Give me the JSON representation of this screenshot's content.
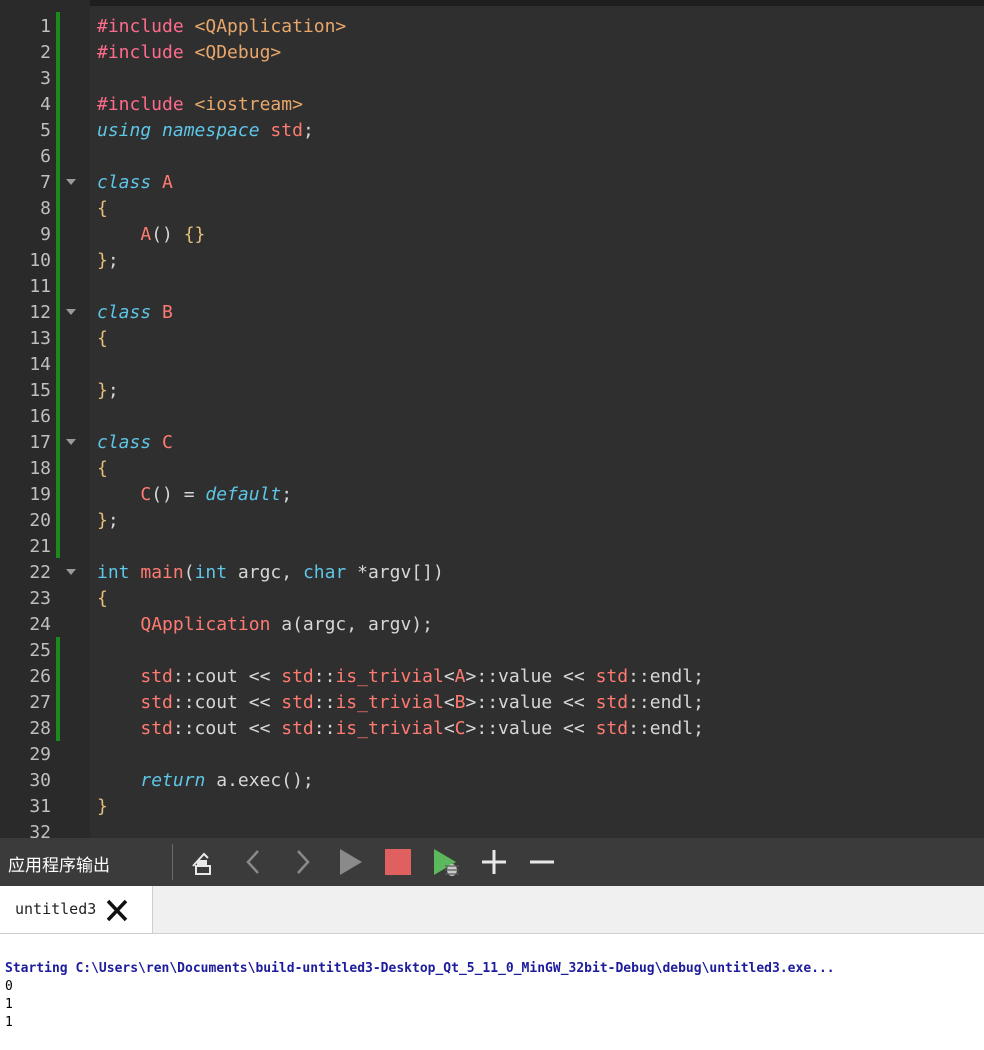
{
  "editor": {
    "lines": [
      {
        "n": "1",
        "tokens": [
          {
            "c": "kw-pp",
            "t": "#include "
          },
          {
            "c": "inc",
            "t": "<QApplication>"
          }
        ]
      },
      {
        "n": "2",
        "tokens": [
          {
            "c": "kw-pp",
            "t": "#include "
          },
          {
            "c": "inc",
            "t": "<QDebug>"
          }
        ]
      },
      {
        "n": "3",
        "tokens": []
      },
      {
        "n": "4",
        "tokens": [
          {
            "c": "kw-pp",
            "t": "#include "
          },
          {
            "c": "inc",
            "t": "<iostream>"
          }
        ]
      },
      {
        "n": "5",
        "tokens": [
          {
            "c": "kw-it",
            "t": "using"
          },
          {
            "c": "plain",
            "t": " "
          },
          {
            "c": "kw-it",
            "t": "namespace"
          },
          {
            "c": "plain",
            "t": " "
          },
          {
            "c": "std",
            "t": "std"
          },
          {
            "c": "plain",
            "t": ";"
          }
        ]
      },
      {
        "n": "6",
        "tokens": []
      },
      {
        "n": "7",
        "fold": true,
        "tokens": [
          {
            "c": "kw-it",
            "t": "class"
          },
          {
            "c": "plain",
            "t": " "
          },
          {
            "c": "type",
            "t": "A"
          }
        ]
      },
      {
        "n": "8",
        "tokens": [
          {
            "c": "punct",
            "t": "{"
          }
        ]
      },
      {
        "n": "9",
        "tokens": [
          {
            "c": "plain",
            "t": "    "
          },
          {
            "c": "type",
            "t": "A"
          },
          {
            "c": "plain",
            "t": "() "
          },
          {
            "c": "punct",
            "t": "{}"
          }
        ]
      },
      {
        "n": "10",
        "tokens": [
          {
            "c": "punct",
            "t": "}"
          },
          {
            "c": "plain",
            "t": ";"
          }
        ]
      },
      {
        "n": "11",
        "tokens": []
      },
      {
        "n": "12",
        "fold": true,
        "tokens": [
          {
            "c": "kw-it",
            "t": "class"
          },
          {
            "c": "plain",
            "t": " "
          },
          {
            "c": "type",
            "t": "B"
          }
        ]
      },
      {
        "n": "13",
        "tokens": [
          {
            "c": "punct",
            "t": "{"
          }
        ]
      },
      {
        "n": "14",
        "tokens": []
      },
      {
        "n": "15",
        "tokens": [
          {
            "c": "punct",
            "t": "}"
          },
          {
            "c": "plain",
            "t": ";"
          }
        ]
      },
      {
        "n": "16",
        "tokens": []
      },
      {
        "n": "17",
        "fold": true,
        "tokens": [
          {
            "c": "kw-it",
            "t": "class"
          },
          {
            "c": "plain",
            "t": " "
          },
          {
            "c": "type",
            "t": "C"
          }
        ]
      },
      {
        "n": "18",
        "tokens": [
          {
            "c": "punct",
            "t": "{"
          }
        ]
      },
      {
        "n": "19",
        "tokens": [
          {
            "c": "plain",
            "t": "    "
          },
          {
            "c": "type",
            "t": "C"
          },
          {
            "c": "plain",
            "t": "() = "
          },
          {
            "c": "kw-it",
            "t": "default"
          },
          {
            "c": "plain",
            "t": ";"
          }
        ]
      },
      {
        "n": "20",
        "tokens": [
          {
            "c": "punct",
            "t": "}"
          },
          {
            "c": "plain",
            "t": ";"
          }
        ]
      },
      {
        "n": "21",
        "tokens": []
      },
      {
        "n": "22",
        "fold": true,
        "tokens": [
          {
            "c": "kw",
            "t": "int"
          },
          {
            "c": "plain",
            "t": " "
          },
          {
            "c": "type",
            "t": "main"
          },
          {
            "c": "plain",
            "t": "("
          },
          {
            "c": "kw",
            "t": "int"
          },
          {
            "c": "plain",
            "t": " argc, "
          },
          {
            "c": "kw",
            "t": "char"
          },
          {
            "c": "plain",
            "t": " *argv[])"
          }
        ]
      },
      {
        "n": "23",
        "tokens": [
          {
            "c": "punct",
            "t": "{"
          }
        ]
      },
      {
        "n": "24",
        "tokens": [
          {
            "c": "plain",
            "t": "    "
          },
          {
            "c": "type",
            "t": "QApplication"
          },
          {
            "c": "plain",
            "t": " a(argc, argv);"
          }
        ]
      },
      {
        "n": "25",
        "tokens": []
      },
      {
        "n": "26",
        "tokens": [
          {
            "c": "plain",
            "t": "    "
          },
          {
            "c": "std",
            "t": "std"
          },
          {
            "c": "plain",
            "t": "::cout << "
          },
          {
            "c": "std",
            "t": "std"
          },
          {
            "c": "plain",
            "t": "::"
          },
          {
            "c": "type",
            "t": "is_trivial"
          },
          {
            "c": "plain",
            "t": "<"
          },
          {
            "c": "type",
            "t": "A"
          },
          {
            "c": "plain",
            "t": ">::value << "
          },
          {
            "c": "std",
            "t": "std"
          },
          {
            "c": "plain",
            "t": "::endl;"
          }
        ]
      },
      {
        "n": "27",
        "tokens": [
          {
            "c": "plain",
            "t": "    "
          },
          {
            "c": "std",
            "t": "std"
          },
          {
            "c": "plain",
            "t": "::cout << "
          },
          {
            "c": "std",
            "t": "std"
          },
          {
            "c": "plain",
            "t": "::"
          },
          {
            "c": "type",
            "t": "is_trivial"
          },
          {
            "c": "plain",
            "t": "<"
          },
          {
            "c": "type",
            "t": "B"
          },
          {
            "c": "plain",
            "t": ">::value << "
          },
          {
            "c": "std",
            "t": "std"
          },
          {
            "c": "plain",
            "t": "::endl;"
          }
        ]
      },
      {
        "n": "28",
        "tokens": [
          {
            "c": "plain",
            "t": "    "
          },
          {
            "c": "std",
            "t": "std"
          },
          {
            "c": "plain",
            "t": "::cout << "
          },
          {
            "c": "std",
            "t": "std"
          },
          {
            "c": "plain",
            "t": "::"
          },
          {
            "c": "type",
            "t": "is_trivial"
          },
          {
            "c": "plain",
            "t": "<"
          },
          {
            "c": "type",
            "t": "C"
          },
          {
            "c": "plain",
            "t": ">::value << "
          },
          {
            "c": "std",
            "t": "std"
          },
          {
            "c": "plain",
            "t": "::endl;"
          }
        ]
      },
      {
        "n": "29",
        "tokens": []
      },
      {
        "n": "30",
        "tokens": [
          {
            "c": "plain",
            "t": "    "
          },
          {
            "c": "kw-it",
            "t": "return"
          },
          {
            "c": "plain",
            "t": " a.exec();"
          }
        ]
      },
      {
        "n": "31",
        "tokens": [
          {
            "c": "punct",
            "t": "}"
          }
        ]
      },
      {
        "n": "32",
        "tokens": []
      }
    ]
  },
  "output_toolbar": {
    "title": "应用程序输出",
    "buttons": [
      "clean-icon",
      "back-icon",
      "forward-icon",
      "run-icon",
      "stop-icon",
      "debug-icon",
      "plus-icon",
      "minus-icon"
    ]
  },
  "output_tab": {
    "label": "untitled3"
  },
  "output": {
    "lines": [
      "Starting C:\\Users\\ren\\Documents\\build-untitled3-Desktop_Qt_5_11_0_MinGW_32bit-Debug\\debug\\untitled3.exe...",
      "0",
      "1",
      "1"
    ]
  },
  "colors": {
    "editor_bg": "#2f2f2f",
    "gutter_bg": "#2a2a2a",
    "change_marker": "#1a8a1a",
    "stop": "#e06060",
    "run_debug": "#5cb85c"
  }
}
